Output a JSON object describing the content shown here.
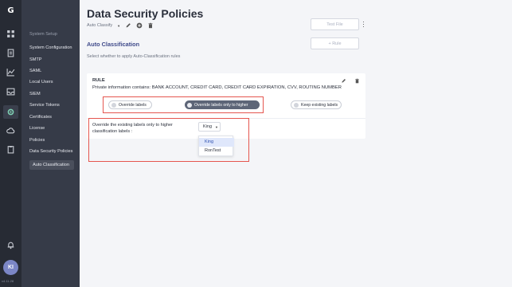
{
  "app": {
    "logo_letter": "G",
    "version": "v4.11.28"
  },
  "rail": {
    "icons": [
      "grid-icon",
      "document-icon",
      "chart-icon",
      "inbox-icon",
      "list-icon",
      "gear-icon",
      "cloud-icon",
      "clipboard-icon",
      "bell-icon"
    ],
    "avatar_initials": "KI"
  },
  "sidebar": {
    "section": "System Setup",
    "items": [
      "System Configuration",
      "SMTP",
      "SAML",
      "Local Users",
      "SIEM",
      "Service Tokens",
      "Certificates",
      "License",
      "Policies",
      "Data Security Policies"
    ],
    "sub_item": "Auto Classification"
  },
  "header": {
    "title": "Data Security Policies",
    "policy_select": "Auto Classify",
    "test_file_label": "Test File",
    "add_rule_label": "+ Rule"
  },
  "section": {
    "title": "Auto Classification",
    "description": "Select whether to apply Auto-Classification rules"
  },
  "rule": {
    "label": "RULE",
    "text": "Private information contains: BANK ACCOUNT, CREDIT CARD, CREDIT CARD EXPIRATION, CVV, ROUTING NUMBER",
    "options": [
      "Override labels",
      "Override labels only to higher",
      "Keep existing labels"
    ],
    "selected": "Override labels only to higher"
  },
  "override": {
    "text": "Override the existing labels only to higher classification labels :",
    "selected": "King",
    "options": [
      "King",
      "RonTest"
    ]
  },
  "colors": {
    "accent": "#3f4a8a",
    "highlight": "#e5564f",
    "sidebar": "#363b48",
    "rail": "#272b34"
  }
}
